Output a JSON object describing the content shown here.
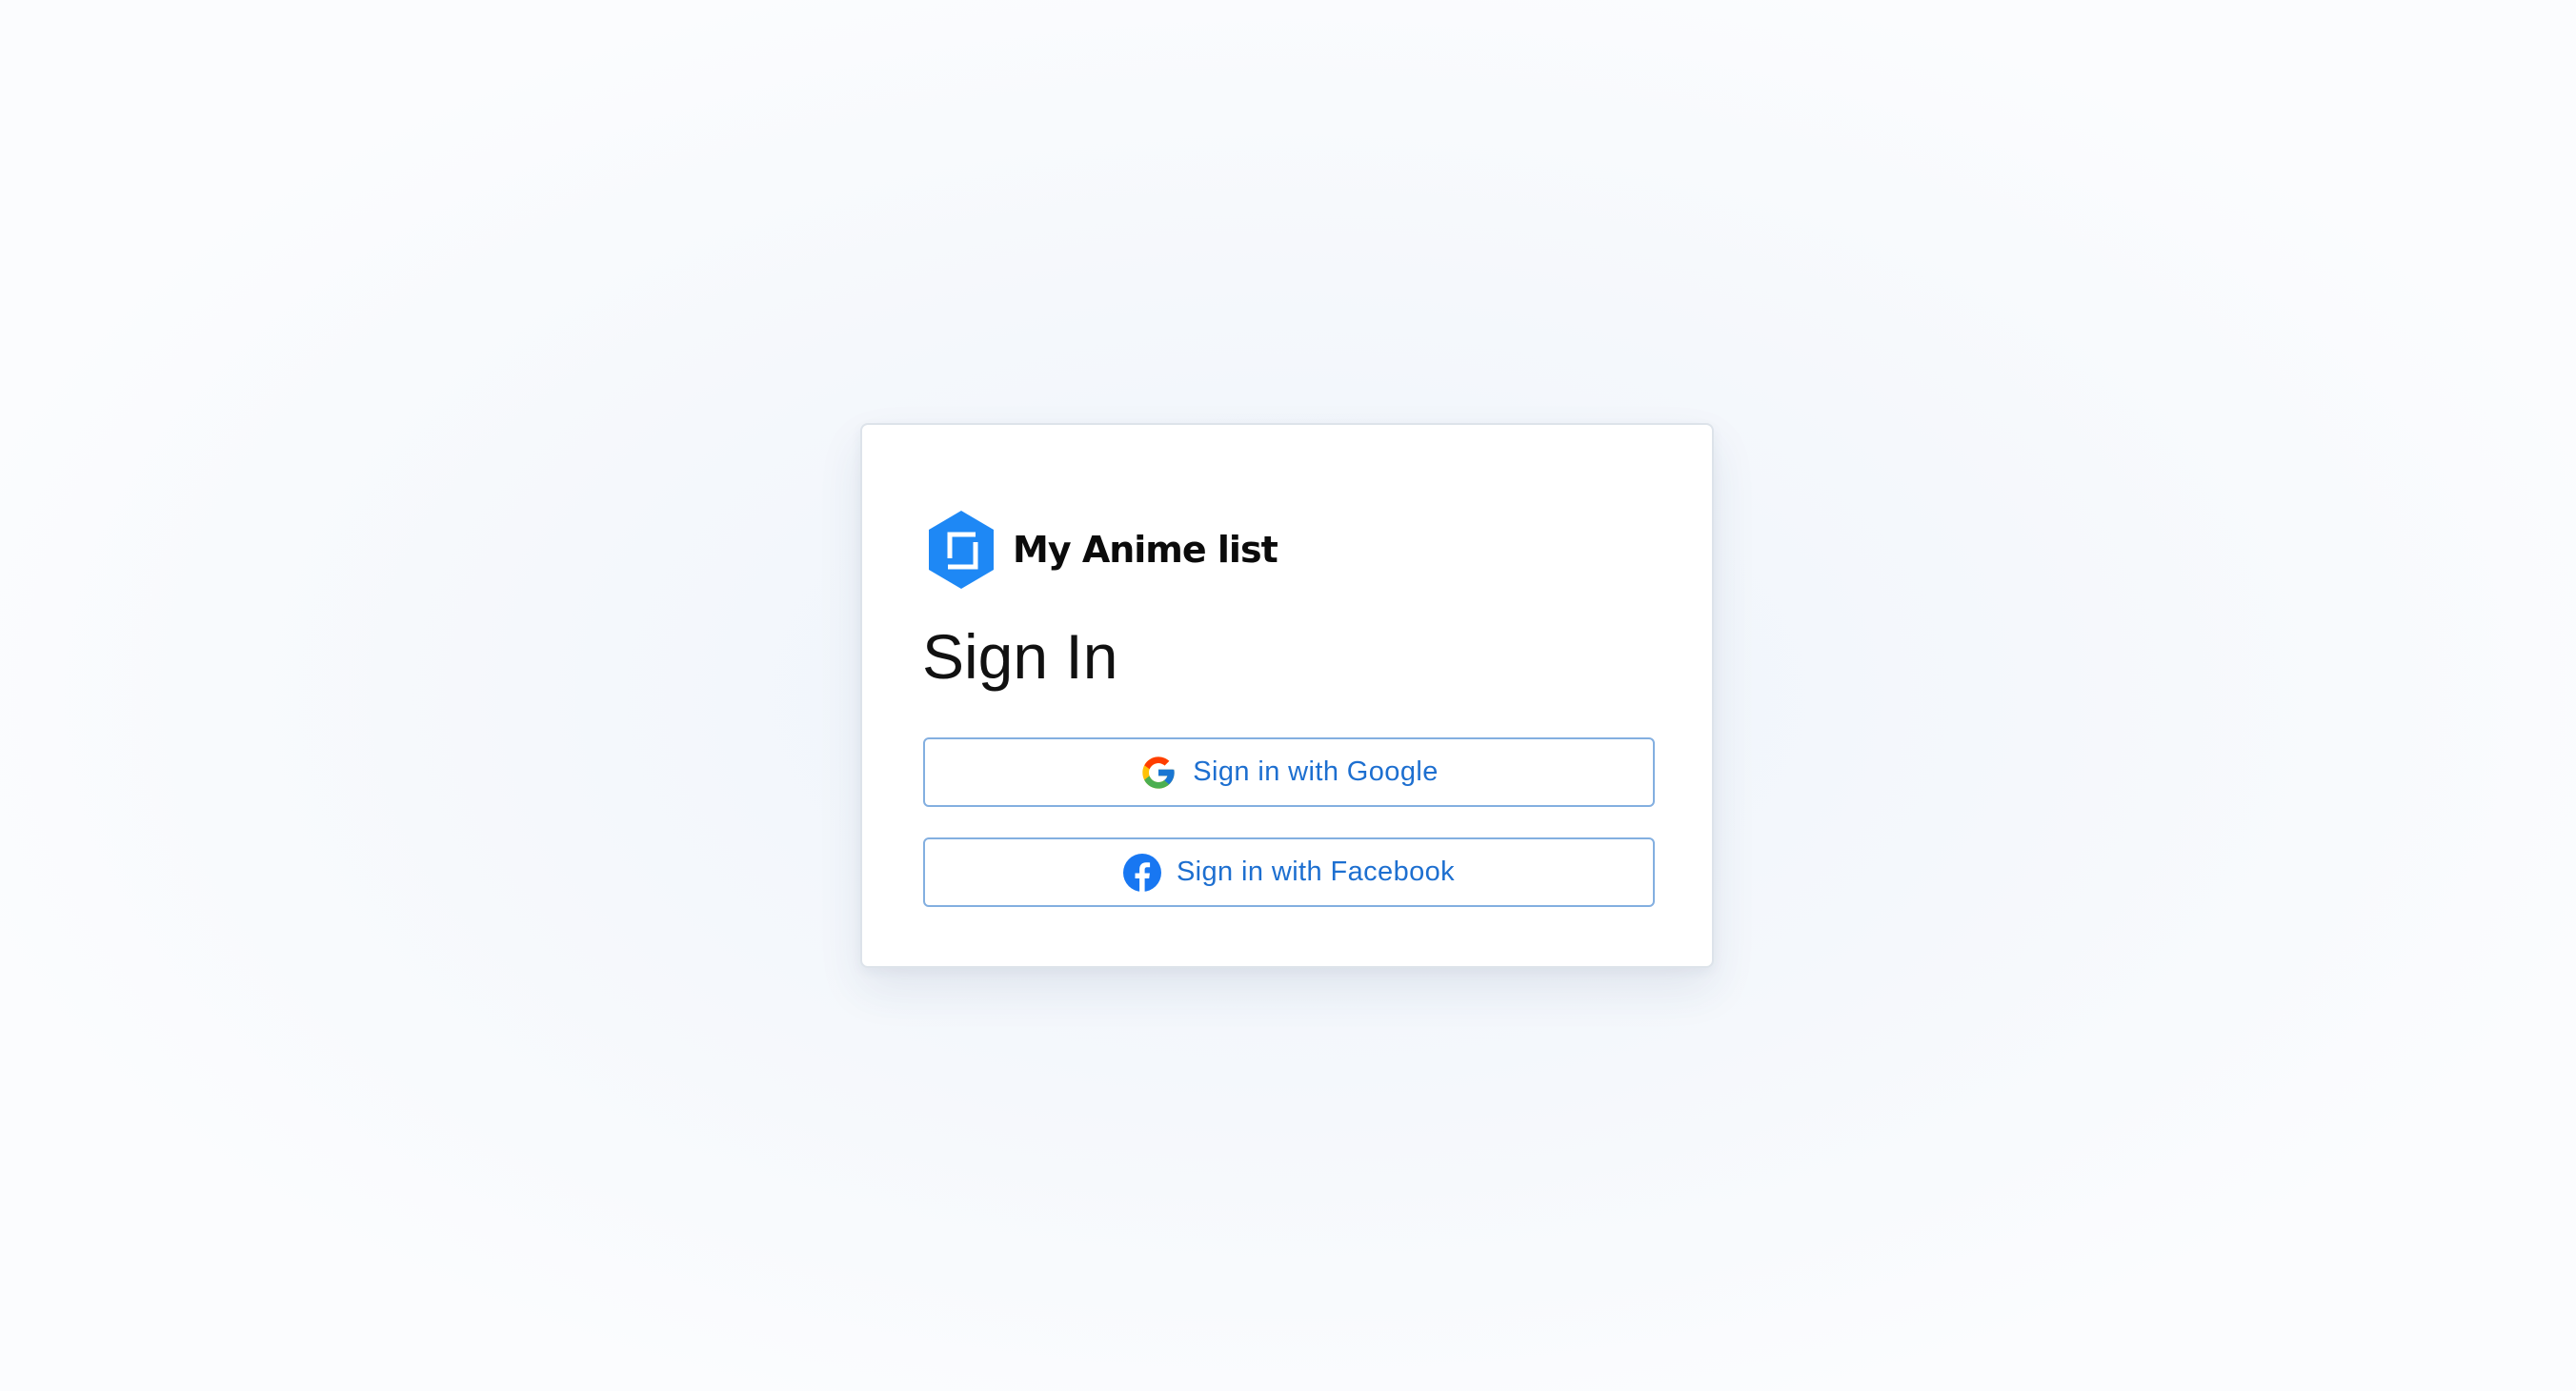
{
  "brand": {
    "name": "My Anime list",
    "logo_icon": "hexagon-cube-logo-icon",
    "color": "#1e88f5"
  },
  "signin": {
    "title": "Sign In",
    "google_label": "Sign in with Google",
    "google_icon": "google-icon",
    "facebook_label": "Sign in with Facebook",
    "facebook_icon": "facebook-icon"
  },
  "colors": {
    "button_text": "#1d6fd0",
    "button_border": "#83afe0",
    "facebook_blue": "#1877f2",
    "page_background": "#f5f8fc"
  }
}
